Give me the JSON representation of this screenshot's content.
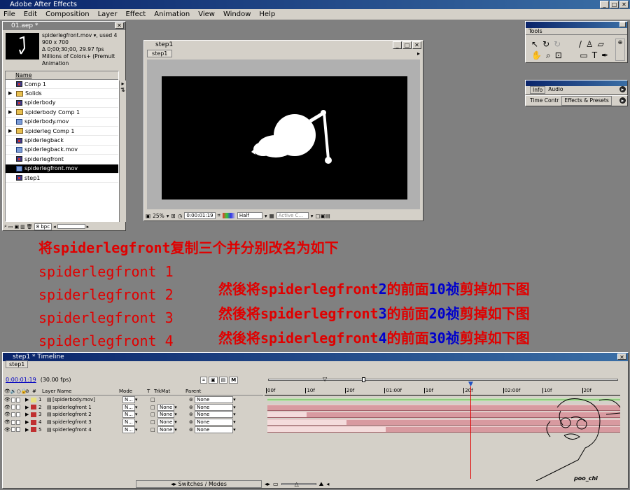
{
  "app": {
    "title": "Adobe After Effects"
  },
  "menu": [
    "File",
    "Edit",
    "Composition",
    "Layer",
    "Effect",
    "Animation",
    "View",
    "Window",
    "Help"
  ],
  "project": {
    "title": "01.aep *",
    "info_name": "spiderlegfront.mov ▾, used 4",
    "info_size": "900 x 700",
    "info_duration": "Δ 0;00;30;00, 29.97 fps",
    "info_colors": "Millions of Colors+ (Premult",
    "info_codec": "Animation",
    "col_name": "Name",
    "items": [
      {
        "name": "Comp 1",
        "type": "comp",
        "expand": false
      },
      {
        "name": "Solids",
        "type": "folder",
        "expand": true
      },
      {
        "name": "spiderbody",
        "type": "comp",
        "expand": false
      },
      {
        "name": "spiderbody Comp 1",
        "type": "folder",
        "expand": true
      },
      {
        "name": "spiderbody.mov",
        "type": "mov",
        "expand": false
      },
      {
        "name": "spiderleg Comp 1",
        "type": "folder",
        "expand": true
      },
      {
        "name": "spiderlegback",
        "type": "comp",
        "expand": false
      },
      {
        "name": "spiderlegback.mov",
        "type": "mov",
        "expand": false
      },
      {
        "name": "spiderlegfront",
        "type": "comp",
        "expand": false
      },
      {
        "name": "spiderlegfront.mov",
        "type": "mov",
        "expand": false,
        "selected": true
      },
      {
        "name": "step1",
        "type": "comp",
        "expand": false
      }
    ],
    "bpc": "8 bpc"
  },
  "comp": {
    "title": "step1",
    "tab": "step1",
    "zoom": "25%",
    "timecode": "0:00:01:19",
    "resolution": "Half",
    "camera": "Active C..."
  },
  "tools": {
    "title": "Tools"
  },
  "info_panel": {
    "tab_info": "Info",
    "tab_audio": "Audio"
  },
  "effects_panel": {
    "tab_time": "Time Contr",
    "tab_effects": "Effects & Presets"
  },
  "notes": {
    "heading": "将spiderlegfront复制三个并分别改名为如下",
    "list": [
      "spiderlegfront 1",
      "spiderlegfront 2",
      "spiderlegfront 3",
      "spiderlegfront 4"
    ],
    "steps": [
      {
        "pre": "然後将spiderlegfront",
        "num": "2",
        "mid": "的前面",
        "frames": "10",
        "unit": "祯",
        "post": "剪掉如下图"
      },
      {
        "pre": "然後将spiderlegfront",
        "num": "3",
        "mid": "的前面",
        "frames": "20",
        "unit": "祯",
        "post": "剪掉如下图"
      },
      {
        "pre": "然後将spiderlegfront",
        "num": "4",
        "mid": "的前面",
        "frames": "30",
        "unit": "祯",
        "post": "剪掉如下图"
      }
    ]
  },
  "timeline": {
    "title": "step1 * Timeline",
    "tab": "step1",
    "timecode": "0:00:01:19",
    "fps": "(30.00 fps)",
    "col_layer": "Layer Name",
    "col_mode": "Mode",
    "col_t": "T",
    "col_trkmat": "TrkMat",
    "col_parent": "Parent",
    "ruler": [
      "00f",
      "10f",
      "20f",
      "01:00f",
      "10f",
      "20f",
      "02:00f",
      "10f",
      "20f"
    ],
    "layers": [
      {
        "num": "1",
        "name": "[spiderbody.mov]",
        "mode": "N...",
        "trkmat": "",
        "parent": "None",
        "color": "#e8e080",
        "start": 0
      },
      {
        "num": "2",
        "name": "spiderlegfront 1",
        "mode": "N...",
        "trkmat": "None",
        "parent": "None",
        "color": "#c03030",
        "start": 0
      },
      {
        "num": "3",
        "name": "spiderlegfront 2",
        "mode": "N...",
        "trkmat": "None",
        "parent": "None",
        "color": "#c03030",
        "start": 10
      },
      {
        "num": "4",
        "name": "spiderlegfront 3",
        "mode": "N...",
        "trkmat": "None",
        "parent": "None",
        "color": "#c03030",
        "start": 20
      },
      {
        "num": "5",
        "name": "spiderlegfront 4",
        "mode": "N...",
        "trkmat": "None",
        "parent": "None",
        "color": "#c03030",
        "start": 30
      }
    ],
    "switches": "Switches / Modes",
    "signature": "poo_chi"
  }
}
